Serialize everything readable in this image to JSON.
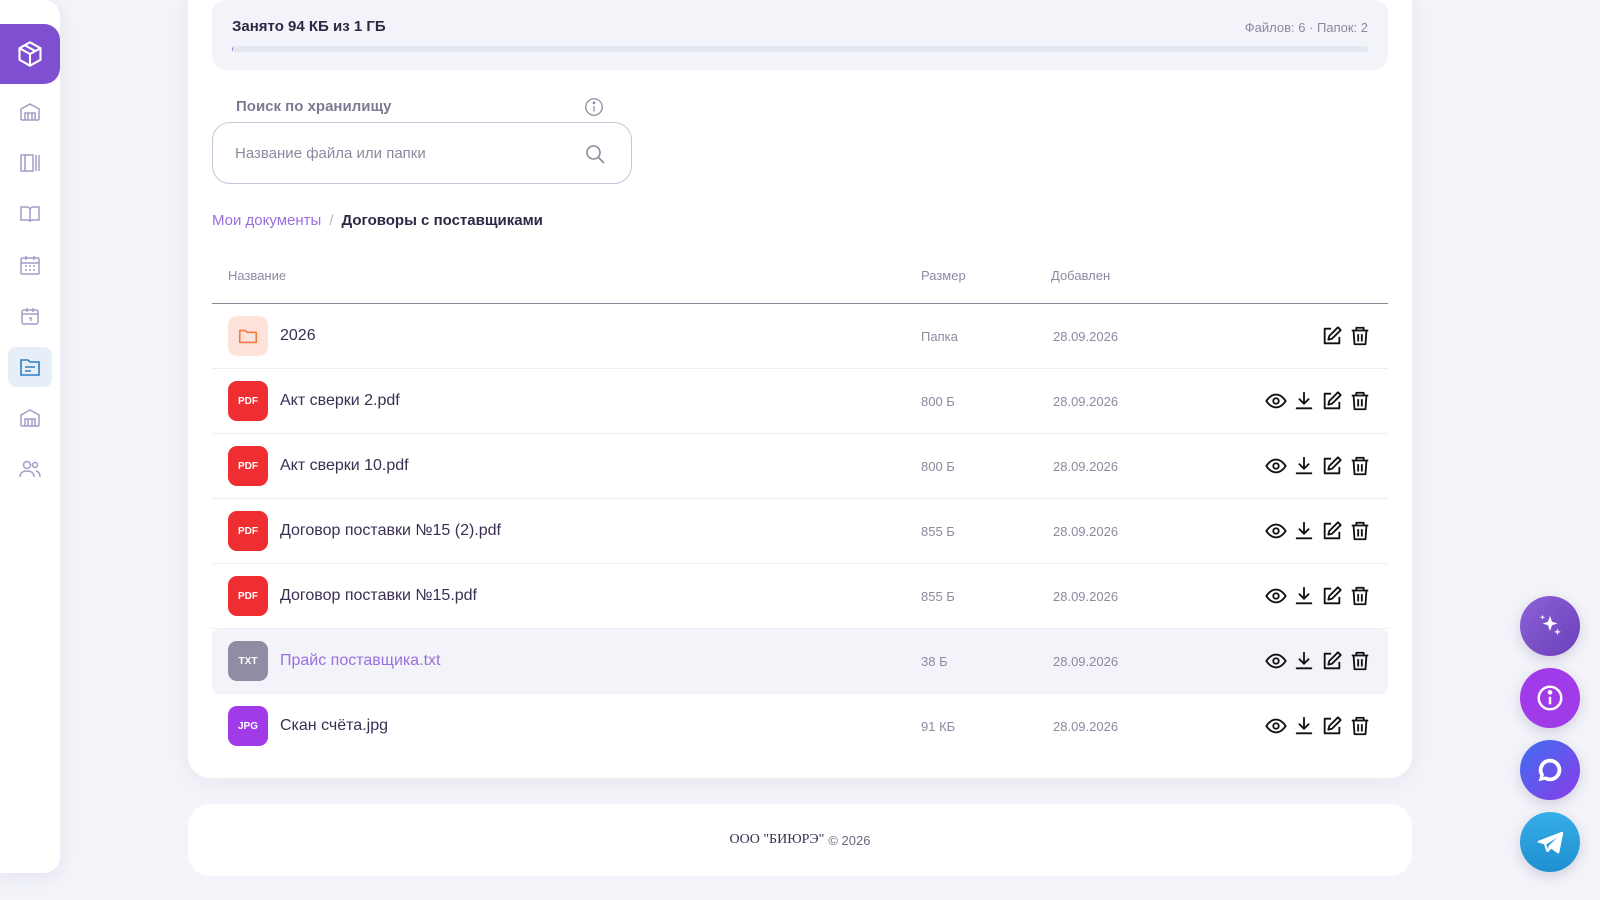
{
  "storage": {
    "title": "Занято 94 КБ из 1 ГБ",
    "counts": "Файлов: 6 · Папок: 2",
    "used_fraction": 0.0001
  },
  "search": {
    "label": "Поиск по хранилищу",
    "placeholder": "Название файла или папки"
  },
  "breadcrumb": {
    "root": "Мои документы",
    "separator": "/",
    "current": "Договоры с поставщиками"
  },
  "table": {
    "headers": {
      "name": "Название",
      "size": "Размер",
      "added": "Добавлен"
    },
    "rows": [
      {
        "type": "folder",
        "badge": "",
        "name": "2026",
        "size": "Папка",
        "date": "28.09.2026",
        "icon": "folder-icon"
      },
      {
        "type": "pdf",
        "badge": "PDF",
        "name": "Акт сверки 2.pdf",
        "size": "800 Б",
        "date": "28.09.2026",
        "icon": "pdf-icon"
      },
      {
        "type": "pdf",
        "badge": "PDF",
        "name": "Акт сверки 10.pdf",
        "size": "800 Б",
        "date": "28.09.2026",
        "icon": "pdf-icon"
      },
      {
        "type": "pdf",
        "badge": "PDF",
        "name": "Договор поставки №15 (2).pdf",
        "size": "855 Б",
        "date": "28.09.2026",
        "icon": "pdf-icon"
      },
      {
        "type": "pdf",
        "badge": "PDF",
        "name": "Договор поставки №15.pdf",
        "size": "855 Б",
        "date": "28.09.2026",
        "icon": "pdf-icon"
      },
      {
        "type": "txt",
        "badge": "TXT",
        "name": "Прайс поставщика.txt",
        "size": "38 Б",
        "date": "28.09.2026",
        "icon": "txt-icon"
      },
      {
        "type": "jpg",
        "badge": "JPG",
        "name": "Скан счёта.jpg",
        "size": "91 КБ",
        "date": "28.09.2026",
        "icon": "jpg-icon"
      }
    ]
  },
  "footer": {
    "org": "ООО \"БИЮРЭ\"",
    "copyright": "© 2026"
  },
  "colors": {
    "accent": "#9b6ee0",
    "logo_bg": "#7e4fd0",
    "pdf": "#ee2e31",
    "txt": "#8f8ca3",
    "jpg": "#a13ae8",
    "folder_bg": "#fde3dc",
    "folder": "#f57b45"
  },
  "sidebar": {
    "items": [
      "logo-cube-icon",
      "warehouse-icon",
      "catalog-icon",
      "book-icon",
      "calendar-grid-icon",
      "calendar-icon",
      "documents-icon",
      "warehouse-icon",
      "users-icon"
    ],
    "active": "documents-icon"
  },
  "fabs": [
    "sparkle-icon",
    "info-icon",
    "chat-icon",
    "telegram-icon"
  ]
}
